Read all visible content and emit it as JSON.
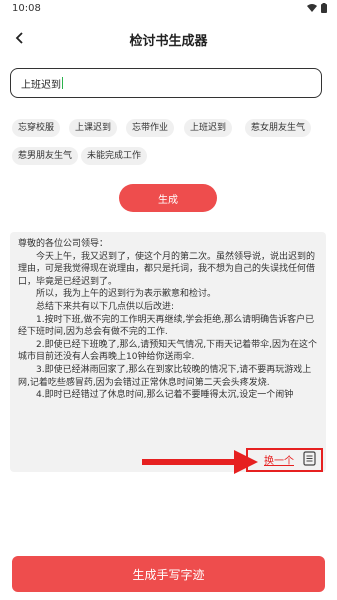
{
  "status": {
    "time": "10:08"
  },
  "header": {
    "title": "检讨书生成器"
  },
  "input": {
    "value": "上班迟到"
  },
  "chips": [
    "忘穿校服",
    "上课迟到",
    "忘带作业",
    "上班迟到",
    "惹女朋友生气",
    "惹男朋友生气",
    "未能完成工作"
  ],
  "generate_label": "生成",
  "result": {
    "lines": [
      "尊敬的各位公司领导：",
      "今天上午，我又迟到了，使这个月的第二次。虽然领导说，说出迟到的理由，可是我觉得现在说理由，都只是托词，我不想为自己的失误找任何借口，毕竟是已经迟到了。",
      "所以，我为上午的迟到行为表示歉意和检讨。",
      "总结下来共有以下几点供以后改进:",
      "1.按时下班,做不完的工作明天再继续,学会拒绝,那么请明确告诉客户已经下班时间,因为总会有做不完的工作.",
      "2.即使已经下班晚了,那么,请预知天气情况,下雨天记着带伞,因为在这个城市目前还没有人会再晚上10钟给你送雨伞.",
      "3.即使已经淋雨回家了,那么在到家比较晚的情况下,请不要再玩游戏上网,记着吃些感冒药,因为会错过正常休息时间第二天会头疼发烧.",
      "4.即时已经错过了休息时间,那么记着不要睡得太沉,设定一个闹钟"
    ]
  },
  "swap_label": "换一个",
  "bottom_button": "生成手写字迹",
  "colors": {
    "accent": "#ee4d4d",
    "annotation": "#e62020"
  }
}
